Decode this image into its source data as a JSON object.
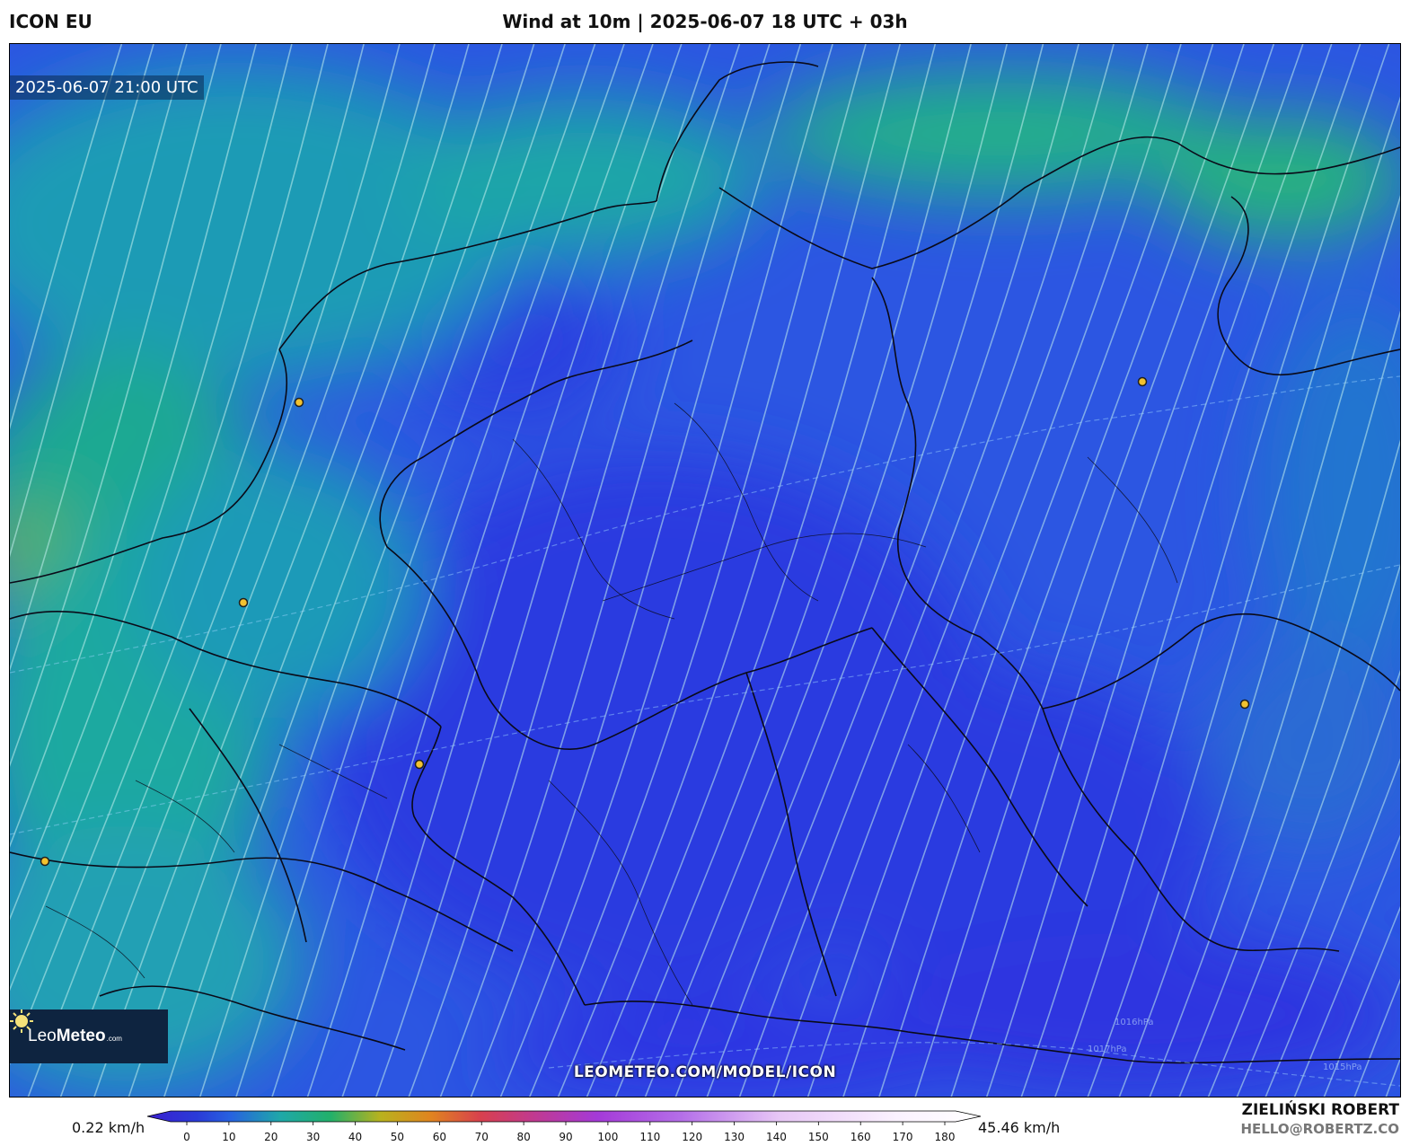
{
  "header": {
    "model": "ICON EU",
    "title": "Wind at 10m | 2025-06-07 18 UTC + 03h"
  },
  "map": {
    "timestamp": "2025-06-07 21:00 UTC",
    "watermark": "LEOMETEO.COM/MODEL/ICON",
    "logo": {
      "name": "Leo",
      "bold": "Meteo",
      "suffix": ".com"
    },
    "isobar_labels": [
      "1017hPa",
      "1016hPa",
      "1015hPa"
    ],
    "colors": {
      "calm": "#2f3fe6",
      "light": "#2b62e6",
      "moderate": "#1fb39a",
      "strong": "#6fb92a",
      "streamline": "#bfeeee",
      "city": "#f2c230"
    }
  },
  "colorbar": {
    "min_label": "0.22 km/h",
    "max_label": "45.46 km/h",
    "ticks": [
      "0",
      "10",
      "20",
      "30",
      "40",
      "50",
      "60",
      "70",
      "80",
      "90",
      "100",
      "110",
      "120",
      "130",
      "140",
      "150",
      "160",
      "170",
      "180"
    ]
  },
  "credits": {
    "author": "ZIELIŃSKI ROBERT",
    "email": "HELLO@ROBERTZ.CO"
  }
}
